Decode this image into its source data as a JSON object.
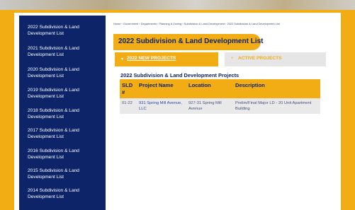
{
  "sidebar": {
    "items": [
      {
        "label": "2022 Subdivision & Land Development List"
      },
      {
        "label": "2021 Subdivision & Land Development List"
      },
      {
        "label": "2020 Subdivision & Land Development List"
      },
      {
        "label": "2019 Subdivision & Land Development List"
      },
      {
        "label": "2018 Subdivision & Land Development List"
      },
      {
        "label": "2017 Subdivision & Land Development List"
      },
      {
        "label": "2016 Subdivision & Land Development List"
      },
      {
        "label": "2015 Subdivision & Land Development List"
      },
      {
        "label": "2014 Subdivision & Land Development List"
      }
    ]
  },
  "breadcrumb": {
    "items": [
      "Home",
      "Government",
      "Departments",
      "Planning & Zoning",
      "Subdivision & Land Development",
      "2022 Subdivision & Land Development List"
    ],
    "separator": " › "
  },
  "page": {
    "title": "2022 Subdivision & Land Development List"
  },
  "tabs": {
    "active": {
      "label": "2022 NEW PROJECTS",
      "icon": "▾"
    },
    "inactive": {
      "label": "ACTIVE PROJECTS",
      "icon": "+"
    }
  },
  "table": {
    "title": "2022 Subdivision & Land Development Projects",
    "headers": {
      "sld": "SLD #",
      "project_name": "Project Name",
      "location": "Location",
      "description": "Description"
    },
    "rows": [
      {
        "sld": "01-22",
        "project_name": "931 Spring Mill Avenue, LLC",
        "location": "927-31 Spring Mill Avenue",
        "description": "Prelim/Final Major LD - 20 Unit Apartment Building"
      }
    ]
  },
  "colors": {
    "accent": "#f2ac14",
    "navy": "#0d2468",
    "row_bg": "#e9e9e9"
  }
}
